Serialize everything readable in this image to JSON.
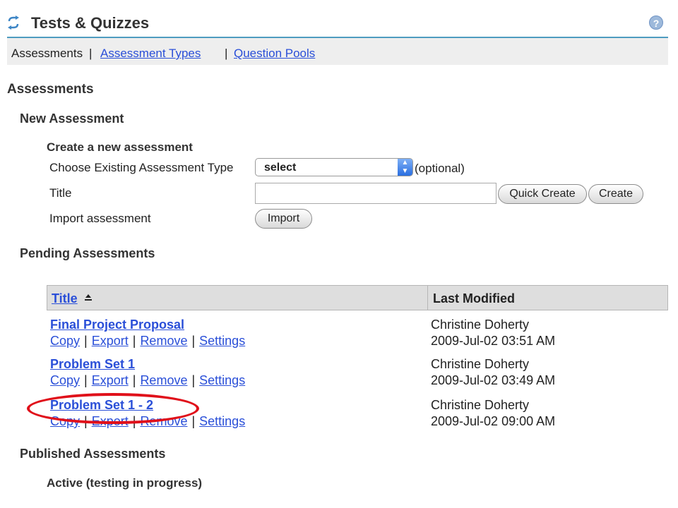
{
  "tool": {
    "title": "Tests & Quizzes",
    "icon": "refresh-arrows-icon",
    "help_icon": "help-icon",
    "help_glyph": "?"
  },
  "nav": {
    "current": "Assessments",
    "separator": "|",
    "links": [
      "Assessment Types",
      "Question Pools"
    ]
  },
  "page": {
    "heading": "Assessments"
  },
  "new_assessment": {
    "heading": "New Assessment",
    "subheading": "Create a new assessment",
    "type_label": "Choose Existing Assessment Type",
    "type_value": "select",
    "optional": "(optional)",
    "title_label": "Title",
    "title_value": "",
    "quick_create": "Quick Create",
    "create": "Create",
    "import_label": "Import assessment",
    "import_button": "Import"
  },
  "pending": {
    "heading": "Pending Assessments",
    "columns": {
      "title": "Title",
      "modified": "Last Modified"
    },
    "actions": [
      "Copy",
      "Export",
      "Remove",
      "Settings"
    ],
    "rows": [
      {
        "title": "Final Project Proposal",
        "author": "Christine Doherty",
        "date": "2009-Jul-02 03:51 AM"
      },
      {
        "title": "Problem Set 1",
        "author": "Christine Doherty",
        "date": "2009-Jul-02 03:49 AM"
      },
      {
        "title": "Problem Set 1 - 2",
        "author": "Christine Doherty",
        "date": "2009-Jul-02 09:00 AM"
      }
    ]
  },
  "published": {
    "heading": "Published Assessments",
    "active": "Active (testing in progress)"
  },
  "colors": {
    "link": "#2a4fd8",
    "rule": "#4e9cc0",
    "highlight": "#e0101a",
    "nav_bg": "#eeeeee",
    "header_bg": "#dedede"
  }
}
